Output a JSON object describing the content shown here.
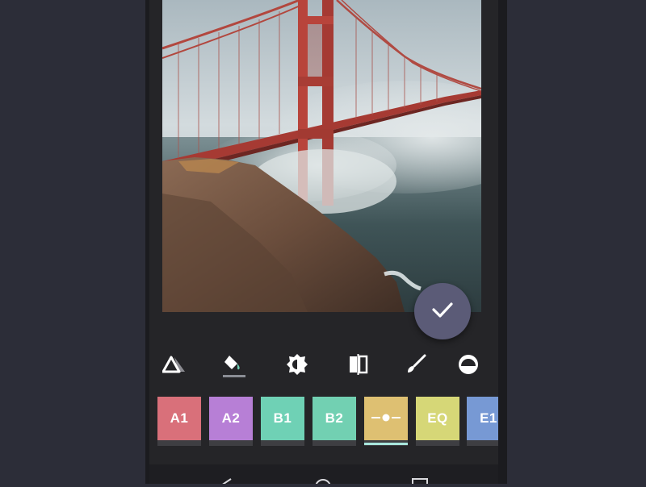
{
  "photo": {
    "subject": "Golden Gate Bridge in fog"
  },
  "confirm_fab": {
    "icon": "check-icon",
    "color": "#5b5b77"
  },
  "tools": [
    {
      "name": "adjust-tool",
      "icon": "triangle-icon"
    },
    {
      "name": "fill-tool",
      "icon": "paint-bucket-icon",
      "selected": true
    },
    {
      "name": "brightness-tool",
      "icon": "brightness-icon"
    },
    {
      "name": "compare-tool",
      "icon": "compare-icon"
    },
    {
      "name": "brush-tool",
      "icon": "brush-icon"
    },
    {
      "name": "vignette-tool",
      "icon": "half-circle-icon"
    }
  ],
  "filters": [
    {
      "label": "A1",
      "color": "#d9707a"
    },
    {
      "label": "A2",
      "color": "#b77fd6"
    },
    {
      "label": "B1",
      "color": "#6fd1b5"
    },
    {
      "label": "B2",
      "color": "#72d0b2"
    },
    {
      "label": "",
      "icon": "slider-icon",
      "color": "#dec072",
      "selected": true
    },
    {
      "label": "EQ",
      "color": "#d6d777"
    },
    {
      "label": "E1",
      "color": "#7799d4"
    }
  ],
  "navbar": {
    "back": "back-icon",
    "home": "home-icon",
    "recents": "recents-icon"
  }
}
